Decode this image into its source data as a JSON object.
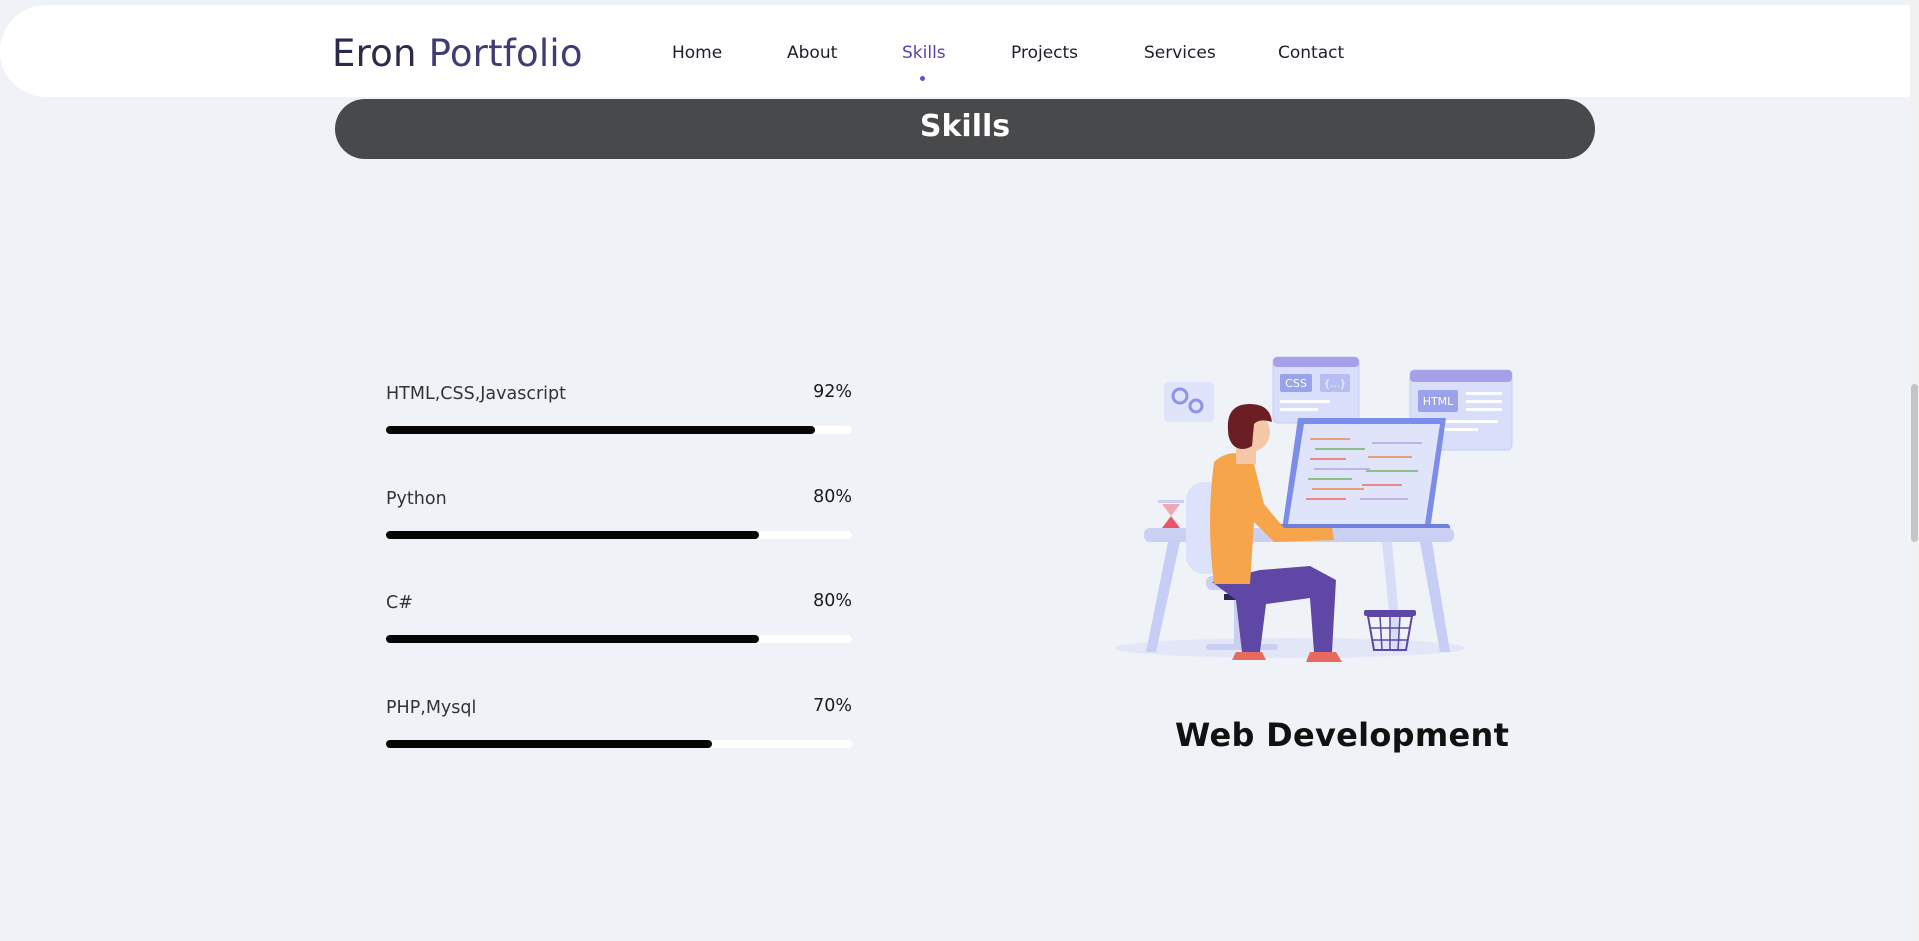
{
  "header": {
    "logo_first": "Eron",
    "logo_second": "Portfolio",
    "nav": [
      {
        "label": "Home"
      },
      {
        "label": "About"
      },
      {
        "label": "Skills",
        "active": true
      },
      {
        "label": "Projects"
      },
      {
        "label": "Services"
      },
      {
        "label": "Contact"
      }
    ]
  },
  "section": {
    "title": "Skills"
  },
  "skills": [
    {
      "name": "HTML,CSS,Javascript",
      "percent_label": "92%",
      "percent": 92
    },
    {
      "name": "Python",
      "percent_label": "80%",
      "percent": 80
    },
    {
      "name": "C#",
      "percent_label": "80%",
      "percent": 80
    },
    {
      "name": "PHP,Mysql",
      "percent_label": "70%",
      "percent": 70
    }
  ],
  "illustration": {
    "css_tag": "CSS",
    "braces_tag": "{...}",
    "html_tag": "HTML"
  },
  "service": {
    "title": "Web Development"
  },
  "colors": {
    "accent": "#5b3fb0",
    "banner": "#48494b",
    "bar_fill": "#050505",
    "background": "#eff3f8"
  }
}
